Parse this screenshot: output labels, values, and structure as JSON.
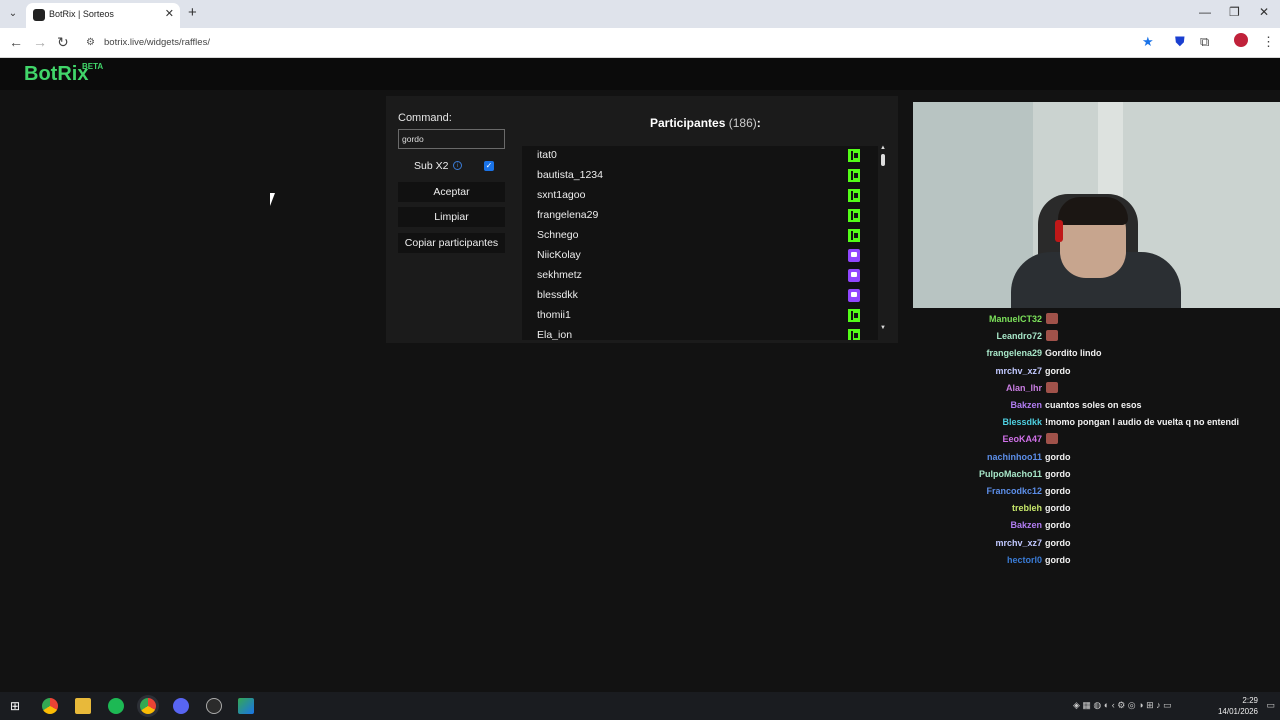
{
  "browser": {
    "tab_title": "BotRix | Sorteos",
    "url": "botrix.live/widgets/raffles/"
  },
  "app": {
    "logo": "BotRix",
    "logo_badge": "BETA"
  },
  "raffle": {
    "command_label": "Command:",
    "command_value": "gordo",
    "sub_label": "Sub X2",
    "sub_checked": true,
    "accept_label": "Aceptar",
    "clear_label": "Limpiar",
    "copy_label": "Copiar participantes",
    "participants_title": "Participantes",
    "participants_count": "(186)",
    "participants_colon": ":",
    "participants": [
      {
        "name": "itat0",
        "platform": "kick"
      },
      {
        "name": "bautista_1234",
        "platform": "kick"
      },
      {
        "name": "sxnt1agoo",
        "platform": "kick"
      },
      {
        "name": "frangelena29",
        "platform": "kick"
      },
      {
        "name": "Schnego",
        "platform": "kick"
      },
      {
        "name": "NiicKolay",
        "platform": "twitch"
      },
      {
        "name": "sekhmetz",
        "platform": "twitch"
      },
      {
        "name": "blessdkk",
        "platform": "twitch"
      },
      {
        "name": "thomii1",
        "platform": "kick"
      },
      {
        "name": "Ela_ion",
        "platform": "kick"
      }
    ]
  },
  "chat": [
    {
      "user": "ManuelCT32",
      "color": "#7be05a",
      "message": "",
      "emote": true
    },
    {
      "user": "Leandro72",
      "color": "#a7e6c8",
      "message": "",
      "emote": true
    },
    {
      "user": "frangelena29",
      "color": "#a7e6c8",
      "message": "Gordito lindo",
      "emote": false
    },
    {
      "user": "mrchv_xz7",
      "color": "#c2c9ff",
      "message": "gordo",
      "emote": false
    },
    {
      "user": "Alan_lhr",
      "color": "#c77ce0",
      "message": "",
      "emote": true
    },
    {
      "user": "Bakzen",
      "color": "#b07cf0",
      "message": "cuantos soles on esos",
      "emote": false
    },
    {
      "user": "Blessdkk",
      "color": "#4ecfe0",
      "message": "!momo pongan l audio de vuelta q no entendi",
      "emote": false
    },
    {
      "user": "EeoKA47",
      "color": "#d070e8",
      "message": "",
      "emote": true
    },
    {
      "user": "nachinhoo11",
      "color": "#5c8ee8",
      "message": "gordo",
      "emote": false
    },
    {
      "user": "PulpoMacho11",
      "color": "#a7e6c8",
      "message": "gordo",
      "emote": false
    },
    {
      "user": "Francodkc12",
      "color": "#5c8ee8",
      "message": "gordo",
      "emote": false
    },
    {
      "user": "trebleh",
      "color": "#c7e86a",
      "message": "gordo",
      "emote": false
    },
    {
      "user": "Bakzen",
      "color": "#b07cf0",
      "message": "gordo",
      "emote": false
    },
    {
      "user": "mrchv_xz7",
      "color": "#c2c9ff",
      "message": "gordo",
      "emote": false
    },
    {
      "user": "hectorl0",
      "color": "#3a7bd5",
      "message": "gordo",
      "emote": false
    }
  ],
  "taskbar": {
    "time": "2:29",
    "date": "14/01/2026"
  }
}
